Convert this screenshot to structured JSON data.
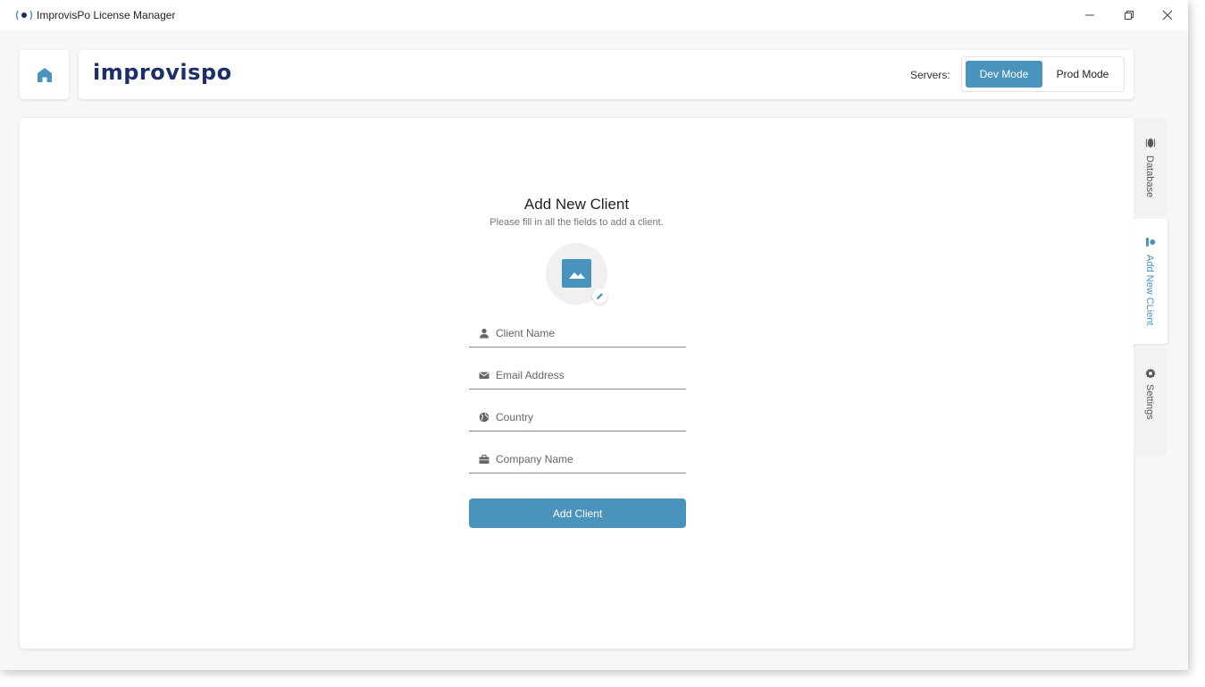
{
  "window": {
    "title": "ImprovisPo License Manager"
  },
  "header": {
    "logo_text": "improvispo",
    "servers_label": "Servers:",
    "modes": [
      {
        "label": "Dev Mode",
        "active": true
      },
      {
        "label": "Prod Mode",
        "active": false
      }
    ]
  },
  "form": {
    "title": "Add New Client",
    "subtitle": "Please fill in all the fields to add a client.",
    "fields": [
      {
        "icon": "person-icon",
        "placeholder": "Client Name"
      },
      {
        "icon": "mail-icon",
        "placeholder": "Email Address"
      },
      {
        "icon": "globe-icon",
        "placeholder": "Country"
      },
      {
        "icon": "briefcase-icon",
        "placeholder": "Company Name"
      }
    ],
    "submit_label": "Add Client"
  },
  "side_tabs": [
    {
      "label": "Database",
      "icon": "database-icon",
      "active": false
    },
    {
      "label": "Add New CLient",
      "icon": "add-user-icon",
      "active": true
    },
    {
      "label": "Settings",
      "icon": "gear-icon",
      "active": false
    }
  ],
  "colors": {
    "accent": "#4993bd",
    "logo": "#1d2f6b",
    "background": "#f7f7f7"
  }
}
